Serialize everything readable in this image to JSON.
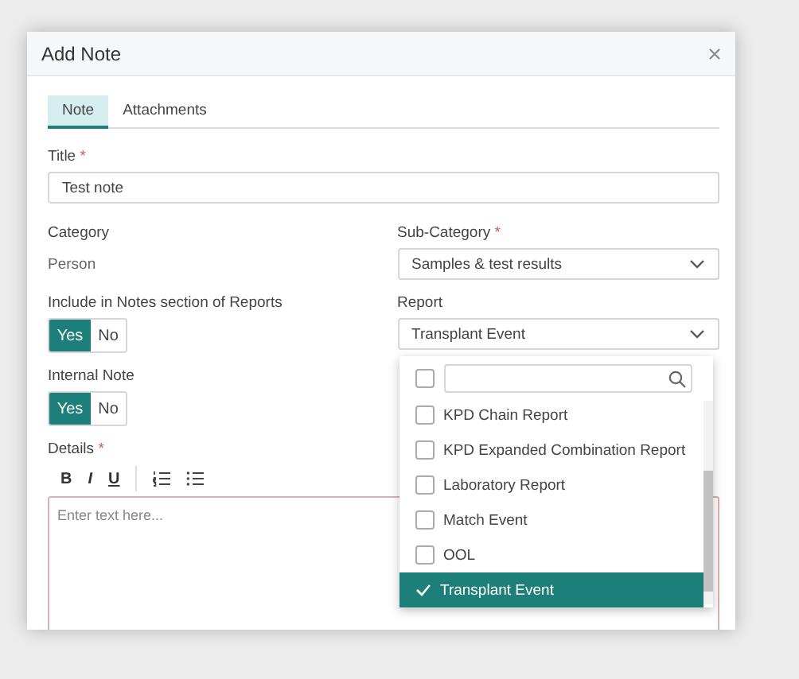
{
  "dialog": {
    "title": "Add Note"
  },
  "tabs": [
    {
      "label": "Note",
      "selected": true
    },
    {
      "label": "Attachments",
      "selected": false
    }
  ],
  "title_field": {
    "label": "Title",
    "required_mark": "*",
    "value": "Test note"
  },
  "category": {
    "label": "Category",
    "value": "Person"
  },
  "sub_category": {
    "label": "Sub-Category",
    "required_mark": "*",
    "value": "Samples & test results"
  },
  "include_in_reports": {
    "label": "Include in Notes section of Reports",
    "options": [
      {
        "label": "Yes",
        "selected": true
      },
      {
        "label": "No",
        "selected": false
      }
    ]
  },
  "report": {
    "label": "Report",
    "value": "Transplant Event",
    "select_all_checked": false,
    "items": [
      {
        "label": "KPD Chain Report",
        "checked": false
      },
      {
        "label": "KPD Expanded Combination Report",
        "checked": false
      },
      {
        "label": "Laboratory Report",
        "checked": false
      },
      {
        "label": "Match Event",
        "checked": false
      },
      {
        "label": "OOL",
        "checked": false
      },
      {
        "label": "Transplant Event",
        "checked": true
      }
    ]
  },
  "internal_note": {
    "label": "Internal Note",
    "options": [
      {
        "label": "Yes",
        "selected": true
      },
      {
        "label": "No",
        "selected": false
      }
    ]
  },
  "details": {
    "label": "Details",
    "required_mark": "*",
    "placeholder": "Enter text here...",
    "toolbar": [
      {
        "kind": "bold",
        "label": "B"
      },
      {
        "kind": "italic",
        "label": "I"
      },
      {
        "kind": "underline",
        "label": "U"
      },
      {
        "kind": "ordered-list"
      },
      {
        "kind": "bullet-list"
      }
    ]
  }
}
